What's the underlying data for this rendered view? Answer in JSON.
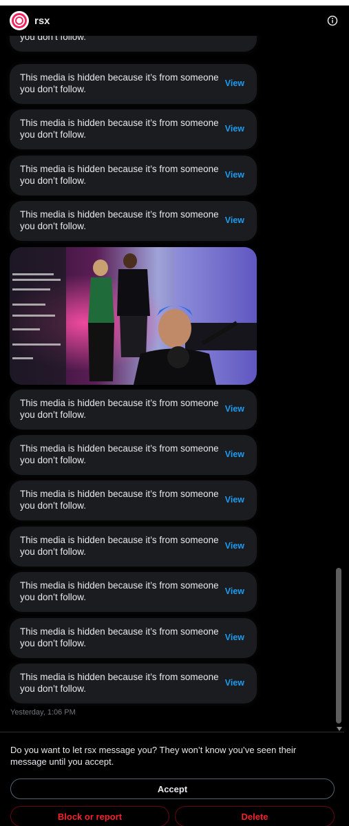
{
  "header": {
    "title": "rsx"
  },
  "hidden_messages": {
    "text": "This media is hidden because it’s from someone you don’t follow.",
    "view_label": "View"
  },
  "timestamp": "Yesterday, 1:06 PM",
  "request": {
    "prompt": "Do you want to let rsx message you? They won’t know you’ve seen their message until you accept.",
    "accept_label": "Accept",
    "block_label": "Block or report",
    "delete_label": "Delete"
  },
  "colors": {
    "accent_blue": "#1d9bf0",
    "danger_red": "#f4212e",
    "bubble_bg": "#1b1c20",
    "avatar_ring": "#f4245e"
  }
}
